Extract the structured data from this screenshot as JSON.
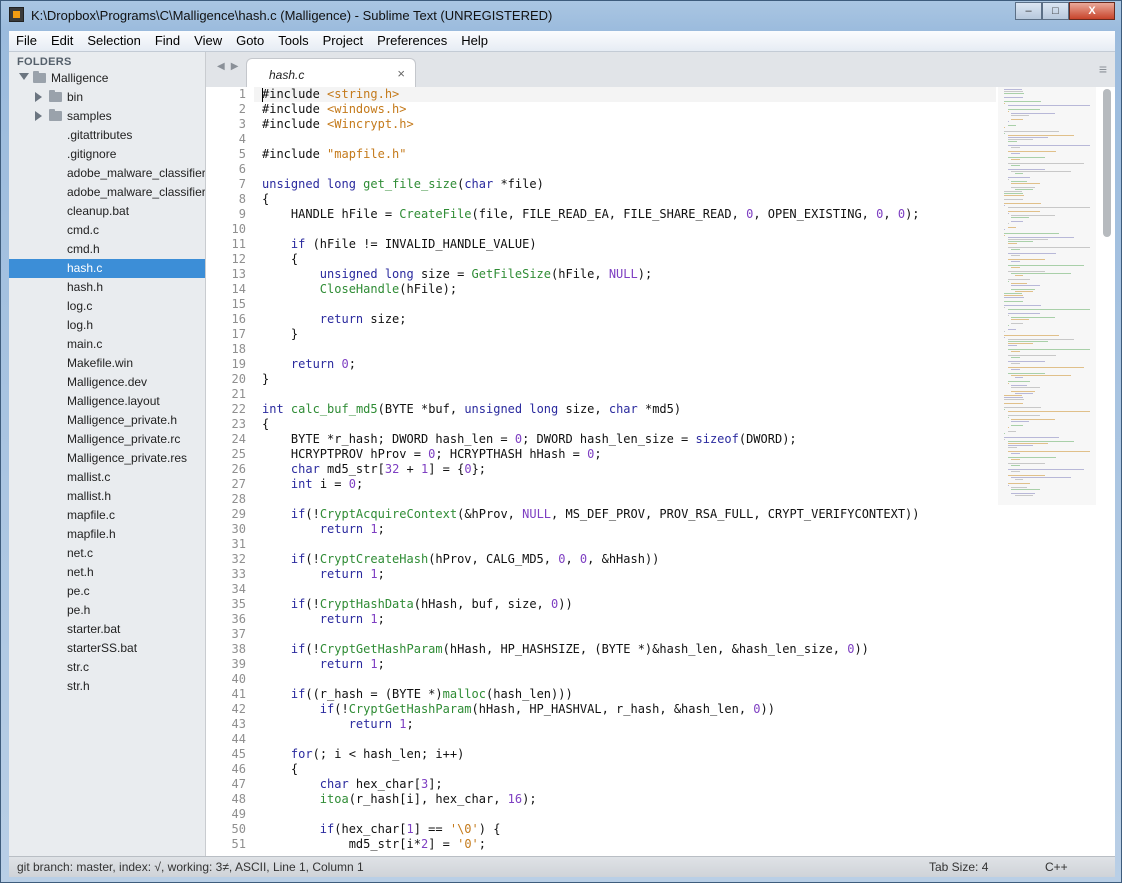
{
  "window": {
    "title": "K:\\Dropbox\\Programs\\C\\Malligence\\hash.c (Malligence) - Sublime Text (UNREGISTERED)",
    "controls": {
      "minimize": "–",
      "maximize": "□",
      "close": "X"
    }
  },
  "menu": [
    "File",
    "Edit",
    "Selection",
    "Find",
    "View",
    "Goto",
    "Tools",
    "Project",
    "Preferences",
    "Help"
  ],
  "sidebar": {
    "header": "FOLDERS",
    "root": "Malligence",
    "folders": [
      "bin",
      "samples"
    ],
    "files": [
      ".gitattributes",
      ".gitignore",
      "adobe_malware_classifier.c",
      "adobe_malware_classifier.h",
      "cleanup.bat",
      "cmd.c",
      "cmd.h",
      "hash.c",
      "hash.h",
      "log.c",
      "log.h",
      "main.c",
      "Makefile.win",
      "Malligence.dev",
      "Malligence.layout",
      "Malligence_private.h",
      "Malligence_private.rc",
      "Malligence_private.res",
      "mallist.c",
      "mallist.h",
      "mapfile.c",
      "mapfile.h",
      "net.c",
      "net.h",
      "pe.c",
      "pe.h",
      "starter.bat",
      "starterSS.bat",
      "str.c",
      "str.h"
    ],
    "selected": "hash.c"
  },
  "tabs": [
    {
      "label": "hash.c",
      "close": "×"
    }
  ],
  "nav": {
    "back": "◀",
    "forward": "▶",
    "tab_menu": "≡"
  },
  "colors": {
    "keyword": "#2a2a9e",
    "string": "#c47a1b",
    "number": "#7e3fc2",
    "function": "#2f8c35",
    "selection": "#3c8ed7"
  },
  "code": [
    "#include <string.h>",
    "#include <windows.h>",
    "#include <Wincrypt.h>",
    "",
    "#include \"mapfile.h\"",
    "",
    "unsigned long get_file_size(char *file)",
    "{",
    "    HANDLE hFile = CreateFile(file, FILE_READ_EA, FILE_SHARE_READ, 0, OPEN_EXISTING, 0, 0);",
    "",
    "    if (hFile != INVALID_HANDLE_VALUE)",
    "    {",
    "        unsigned long size = GetFileSize(hFile, NULL);",
    "        CloseHandle(hFile);",
    "",
    "        return size;",
    "    }",
    "",
    "    return 0;",
    "}",
    "",
    "int calc_buf_md5(BYTE *buf, unsigned long size, char *md5)",
    "{",
    "    BYTE *r_hash; DWORD hash_len = 0; DWORD hash_len_size = sizeof(DWORD);",
    "    HCRYPTPROV hProv = 0; HCRYPTHASH hHash = 0;",
    "    char md5_str[32 + 1] = {0};",
    "    int i = 0;",
    "",
    "    if(!CryptAcquireContext(&hProv, NULL, MS_DEF_PROV, PROV_RSA_FULL, CRYPT_VERIFYCONTEXT))",
    "        return 1;",
    "",
    "    if(!CryptCreateHash(hProv, CALG_MD5, 0, 0, &hHash))",
    "        return 1;",
    "",
    "    if(!CryptHashData(hHash, buf, size, 0))",
    "        return 1;",
    "",
    "    if(!CryptGetHashParam(hHash, HP_HASHSIZE, (BYTE *)&hash_len, &hash_len_size, 0))",
    "        return 1;",
    "",
    "    if((r_hash = (BYTE *)malloc(hash_len)))",
    "        if(!CryptGetHashParam(hHash, HP_HASHVAL, r_hash, &hash_len, 0))",
    "            return 1;",
    "",
    "    for(; i < hash_len; i++)",
    "    {",
    "        char hex_char[3];",
    "        itoa(r_hash[i], hex_char, 16);",
    "",
    "        if(hex_char[1] == '\\0') {",
    "            md5_str[i*2] = '0';"
  ],
  "status": {
    "left": "git branch: master, index: √, working: 3≠, ASCII, Line 1, Column 1",
    "tab_size": "Tab Size: 4",
    "syntax": "C++"
  }
}
